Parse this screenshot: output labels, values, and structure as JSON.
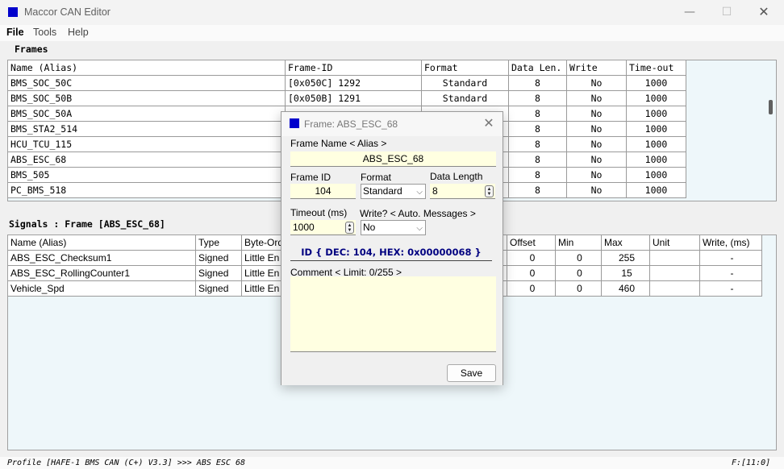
{
  "window": {
    "title": "Maccor CAN Editor",
    "min_glyph": "—",
    "max_glyph": "☐",
    "close_glyph": "✕"
  },
  "menu": {
    "file": "File",
    "tools": "Tools",
    "help": "Help"
  },
  "frames": {
    "label": "Frames",
    "columns": [
      "Name (Alias)",
      "Frame-ID",
      "Format",
      "Data Len.",
      "Write",
      "Time-out"
    ],
    "rows": [
      [
        "BMS_SOC_50C",
        "[0x050C] 1292",
        "Standard",
        "8",
        "No",
        "1000"
      ],
      [
        "BMS_SOC_50B",
        "[0x050B] 1291",
        "Standard",
        "8",
        "No",
        "1000"
      ],
      [
        "BMS_SOC_50A",
        "",
        "",
        "8",
        "No",
        "1000"
      ],
      [
        "BMS_STA2_514",
        "",
        "",
        "8",
        "No",
        "1000"
      ],
      [
        "HCU_TCU_115",
        "",
        "",
        "8",
        "No",
        "1000"
      ],
      [
        "ABS_ESC_68",
        "",
        "",
        "8",
        "No",
        "1000"
      ],
      [
        "BMS_505",
        "",
        "",
        "8",
        "No",
        "1000"
      ],
      [
        "PC_BMS_518",
        "",
        "",
        "8",
        "No",
        "1000"
      ]
    ]
  },
  "signals": {
    "label": "Signals : Frame [ABS_ESC_68]",
    "columns": [
      "Name (Alias)",
      "Type",
      "Byte-Ord",
      "Offset",
      "Min",
      "Max",
      "Unit",
      "Write, (ms)"
    ],
    "rows": [
      [
        "ABS_ESC_Checksum1",
        "Signed",
        "Little En",
        "0",
        "0",
        "255",
        "",
        "-"
      ],
      [
        "ABS_ESC_RollingCounter1",
        "Signed",
        "Little En",
        "0",
        "0",
        "15",
        "",
        "-"
      ],
      [
        "Vehicle_Spd",
        "Signed",
        "Little En",
        "0",
        "0",
        "460",
        "",
        "-"
      ]
    ]
  },
  "dialog": {
    "title": "Frame: ABS_ESC_68",
    "close_glyph": "✕",
    "name_label": "Frame Name < Alias >",
    "name_value": "ABS_ESC_68",
    "id_label": "Frame ID",
    "id_value": "104",
    "format_label": "Format",
    "format_value": "Standard",
    "dlen_label": "Data Length",
    "dlen_value": "8",
    "timeout_label": "Timeout (ms)",
    "timeout_value": "1000",
    "write_label": "Write? < Auto. Messages >",
    "write_value": "No",
    "id_info": "ID { DEC: 104, HEX: 0x00000068 }",
    "comment_label": "Comment < Limit: 0/255 >",
    "save_label": "Save",
    "chevron_glyph": "⌵",
    "spin_up": "▲",
    "spin_down": "▼"
  },
  "status": {
    "left": "Profile [HAFE-1 BMS CAN (C+) V3.3] >>> ABS ESC 68",
    "right": "F:[11:0]"
  },
  "colors": {
    "accent_icon": "#0000cc",
    "panel_bg": "#eef7fa",
    "input_bg": "#ffffe1",
    "id_info_text": "#000080"
  }
}
